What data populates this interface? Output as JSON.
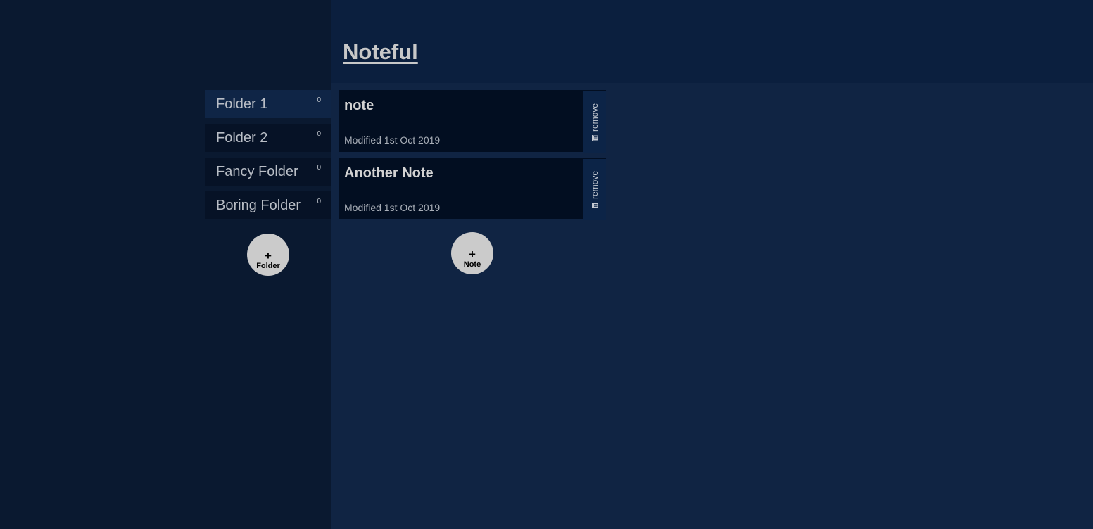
{
  "app": {
    "title": "Noteful"
  },
  "sidebar": {
    "folders": [
      {
        "name": "Folder 1",
        "count": "0",
        "active": true
      },
      {
        "name": "Folder 2",
        "count": "0",
        "active": false
      },
      {
        "name": "Fancy Folder",
        "count": "0",
        "active": false
      },
      {
        "name": "Boring Folder",
        "count": "0",
        "active": false
      }
    ],
    "add_button": {
      "plus": "+",
      "label": "Folder"
    }
  },
  "main": {
    "notes": [
      {
        "title": "note",
        "modified": "Modified 1st Oct 2019",
        "remove_label": "remove",
        "remove_icon": "trash-icon"
      },
      {
        "title": "Another Note",
        "modified": "Modified 1st Oct 2019",
        "remove_label": "remove",
        "remove_icon": "trash-icon"
      }
    ],
    "add_button": {
      "plus": "+",
      "label": "Note"
    }
  },
  "colors": {
    "sidebar_bg": "#0a1930",
    "header_bg": "#0b1f3e",
    "main_bg": "#102443",
    "item_bg": "#061226",
    "active_item_bg": "#0f2546",
    "note_bg": "#020e21",
    "remove_bg": "#0c2447",
    "circle_button_bg": "#cbcbcb"
  }
}
